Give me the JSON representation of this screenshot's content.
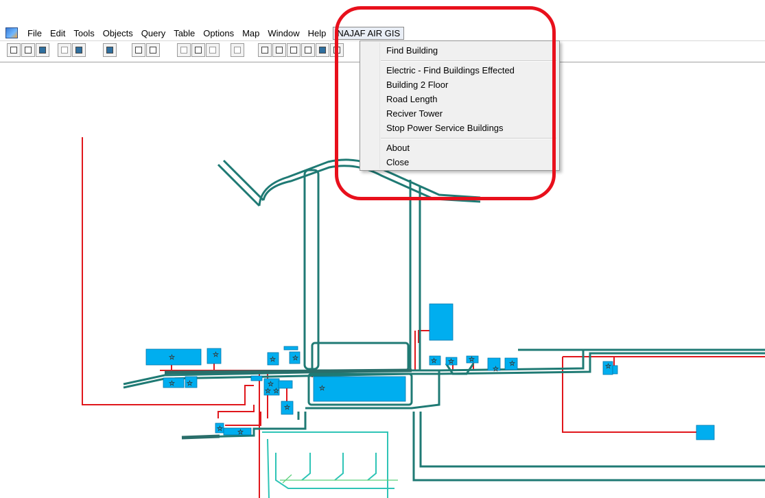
{
  "menubar": {
    "items": [
      "File",
      "Edit",
      "Tools",
      "Objects",
      "Query",
      "Table",
      "Options",
      "Map",
      "Window",
      "Help"
    ],
    "active_item": "NAJAF AIR GIS"
  },
  "dropdown": {
    "items": [
      {
        "label": "Find Building"
      },
      {
        "label": "Electric - Find Buildings Effected"
      },
      {
        "label": "Building 2 Floor"
      },
      {
        "label": "Road Length"
      },
      {
        "label": "Reciver Tower"
      },
      {
        "label": "Stop Power Service Buildings"
      },
      {
        "label": "About"
      },
      {
        "label": "Close"
      }
    ]
  },
  "colors": {
    "road": "#1f7a74",
    "road_light": "#2ec4b6",
    "power_line": "#e0161b",
    "building": "#00aeef",
    "highlight": "#e8101c",
    "grass_line": "#5ad07a"
  },
  "icons": {
    "app": "app-icon",
    "toolbar": [
      "new-icon",
      "open-icon",
      "table-icon",
      "save-icon",
      "save-copy-icon",
      "open-folder-icon",
      "layout-icon",
      "print-icon",
      "cut-icon",
      "copy-icon",
      "paste-icon",
      "undo-icon",
      "browser-icon",
      "mapper-icon",
      "graph-icon",
      "layout-window-icon",
      "redistrict-icon",
      "select-arrow-icon"
    ],
    "building_marker": "star-icon"
  }
}
